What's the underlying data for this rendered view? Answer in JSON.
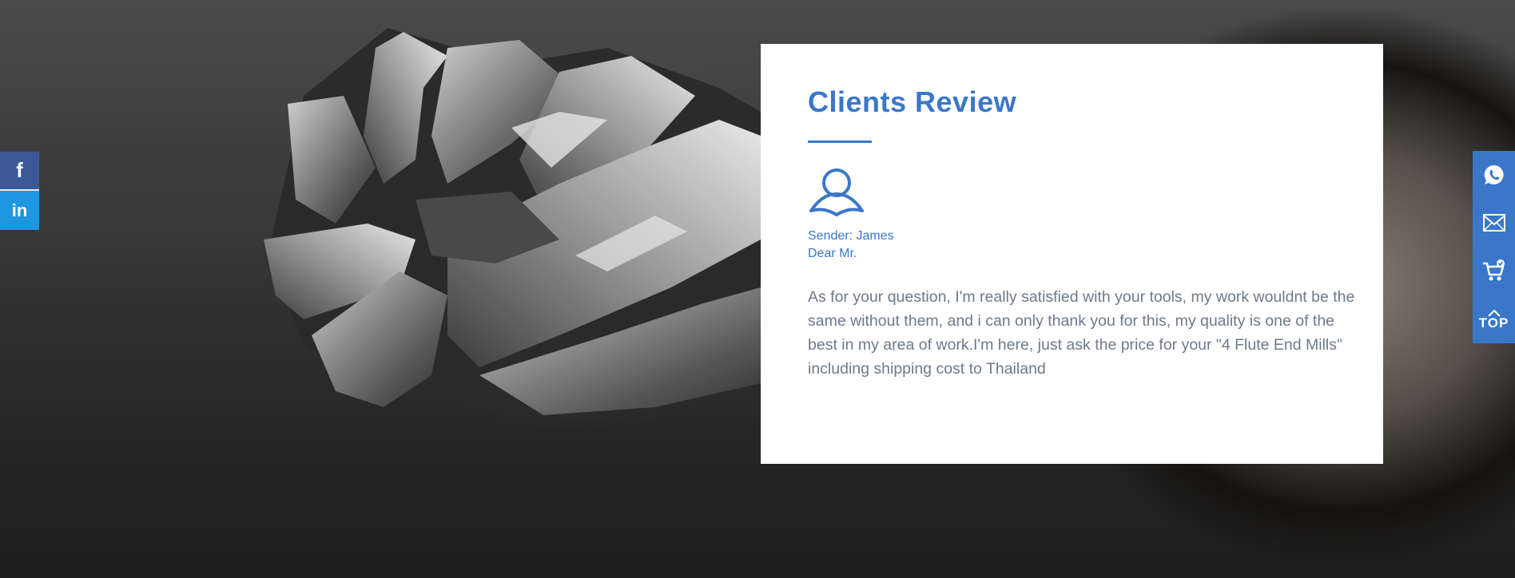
{
  "review": {
    "title": "Clients Review",
    "sender": "Sender: James",
    "salutation": "Dear Mr.",
    "body": "As for your question, I'm really satisfied with your tools, my work wouldnt be the same without them, and i can only thank you for this, my quality is one of the best in my area of work.I'm here, just ask the price for your \"4 Flute End Mills\" including shipping cost to Thailand"
  },
  "social": {
    "facebook_glyph": "f",
    "linkedin_glyph": "in",
    "icons": [
      "facebook-icon",
      "linkedin-icon"
    ]
  },
  "contact": {
    "icons": [
      "whatsapp-icon",
      "mail-icon",
      "cart-icon",
      "arrow-up-icon"
    ],
    "top_label": "TOP"
  },
  "colors": {
    "accent": "#3a77c9",
    "body_text": "#6d7a8a",
    "facebook": "#3b5998",
    "linkedin": "#1e96e0"
  }
}
